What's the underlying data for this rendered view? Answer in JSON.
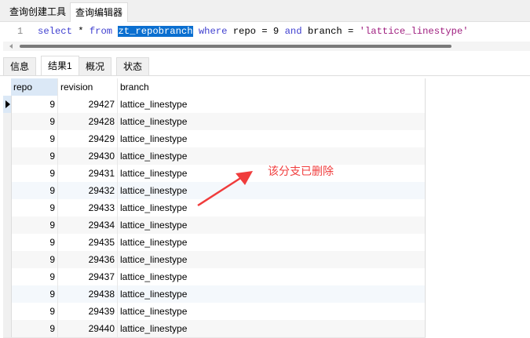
{
  "top_tabs": [
    "查询创建工具",
    "查询编辑器"
  ],
  "editor": {
    "line": "1",
    "sql": [
      {
        "t": "select",
        "c": "kw"
      },
      {
        "t": " * ",
        "c": ""
      },
      {
        "t": "from",
        "c": "kw"
      },
      {
        "t": " ",
        "c": ""
      },
      {
        "t": "zt_repobranch",
        "c": "sel"
      },
      {
        "t": " ",
        "c": ""
      },
      {
        "t": "where",
        "c": "kw"
      },
      {
        "t": " repo = 9 ",
        "c": ""
      },
      {
        "t": "and",
        "c": "kw"
      },
      {
        "t": " branch = ",
        "c": ""
      },
      {
        "t": "'lattice_linestype'",
        "c": "str"
      }
    ]
  },
  "result_tabs": [
    "信息",
    "结果1",
    "概况",
    "状态"
  ],
  "columns": [
    "repo",
    "revision",
    "branch"
  ],
  "rows": [
    [
      "9",
      "29427",
      "lattice_linestype"
    ],
    [
      "9",
      "29428",
      "lattice_linestype"
    ],
    [
      "9",
      "29429",
      "lattice_linestype"
    ],
    [
      "9",
      "29430",
      "lattice_linestype"
    ],
    [
      "9",
      "29431",
      "lattice_linestype"
    ],
    [
      "9",
      "29432",
      "lattice_linestype"
    ],
    [
      "9",
      "29433",
      "lattice_linestype"
    ],
    [
      "9",
      "29434",
      "lattice_linestype"
    ],
    [
      "9",
      "29435",
      "lattice_linestype"
    ],
    [
      "9",
      "29436",
      "lattice_linestype"
    ],
    [
      "9",
      "29437",
      "lattice_linestype"
    ],
    [
      "9",
      "29438",
      "lattice_linestype"
    ],
    [
      "9",
      "29439",
      "lattice_linestype"
    ],
    [
      "9",
      "29440",
      "lattice_linestype"
    ]
  ],
  "annotation": "该分支已删除",
  "colors": {
    "annotation": "#f03c3c",
    "selection": "#0a6fd0"
  }
}
